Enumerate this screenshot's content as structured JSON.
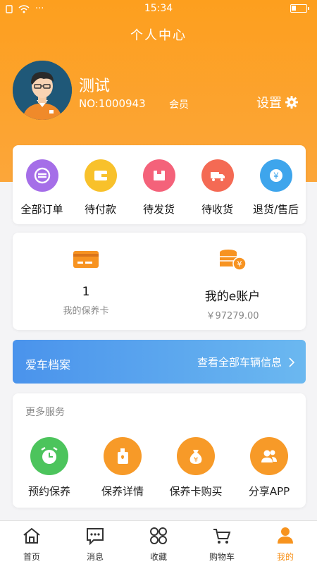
{
  "status_bar": {
    "time": "15:34",
    "signal_text": "···",
    "battery_level": 0.3
  },
  "header": {
    "title": "个人中心"
  },
  "user": {
    "name": "测试",
    "number": "NO:1000943",
    "level": "会员",
    "settings_label": "设置"
  },
  "orders": [
    {
      "label": "全部订单",
      "icon": "all-orders-icon",
      "color": "#a56ee8"
    },
    {
      "label": "待付款",
      "icon": "wallet-icon",
      "color": "#f8c12b"
    },
    {
      "label": "待发货",
      "icon": "package-icon",
      "color": "#f4627a"
    },
    {
      "label": "待收货",
      "icon": "truck-icon",
      "color": "#f46a54"
    },
    {
      "label": "退货/售后",
      "icon": "refund-icon",
      "color": "#3ea5ec"
    }
  ],
  "accounts": {
    "card": {
      "value": "1",
      "label": "我的保养卡"
    },
    "eaccount": {
      "title": "我的e账户",
      "balance": "￥97279.00"
    }
  },
  "car_banner": {
    "title": "爱车档案",
    "link": "查看全部车辆信息"
  },
  "services": {
    "heading": "更多服务",
    "items": [
      {
        "label": "预约保养",
        "icon": "alarm-clock-icon",
        "color": "#4cc45c"
      },
      {
        "label": "保养详情",
        "icon": "oil-can-icon",
        "color": "#f79a28"
      },
      {
        "label": "保养卡购买",
        "icon": "money-bag-icon",
        "color": "#f79a28"
      },
      {
        "label": "分享APP",
        "icon": "users-icon",
        "color": "#f79a28"
      }
    ]
  },
  "tabbar": {
    "items": [
      {
        "label": "首页",
        "icon": "home-icon"
      },
      {
        "label": "消息",
        "icon": "message-icon"
      },
      {
        "label": "收藏",
        "icon": "favorites-icon"
      },
      {
        "label": "购物车",
        "icon": "cart-icon"
      },
      {
        "label": "我的",
        "icon": "profile-icon"
      }
    ],
    "active_index": 4,
    "active_color": "#f7931e"
  },
  "colors": {
    "brand_orange": "#fd9f1e",
    "banner_blue": "#4a93ec"
  }
}
